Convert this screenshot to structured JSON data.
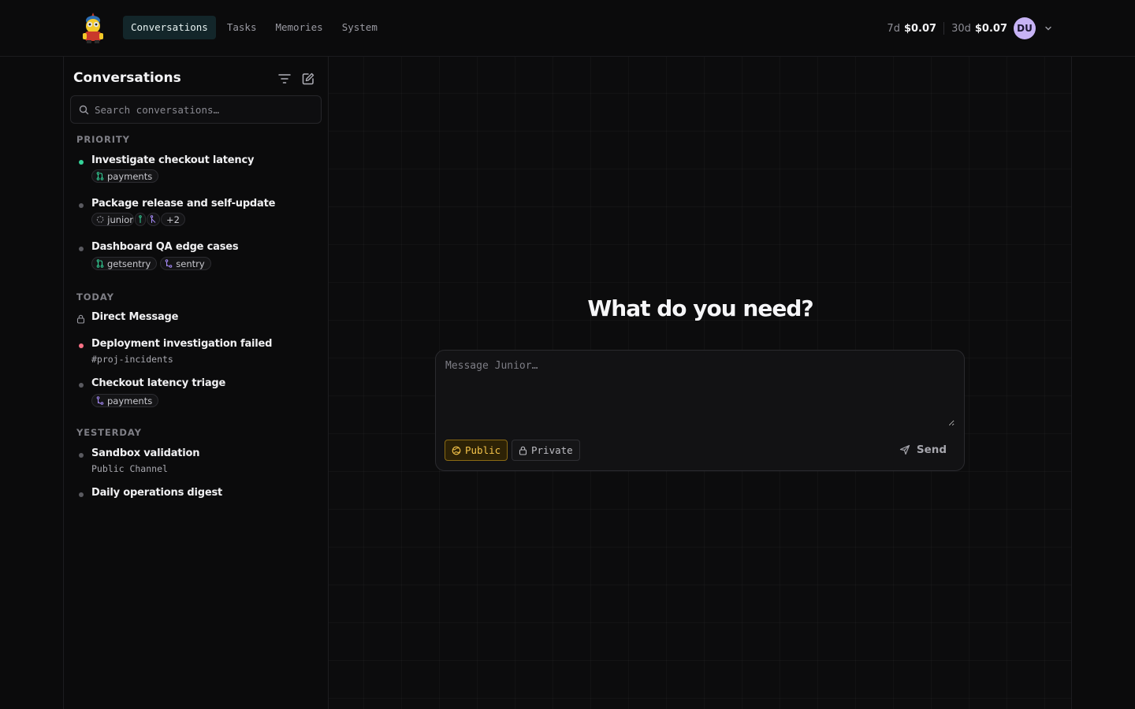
{
  "nav": {
    "tabs": [
      {
        "label": "Conversations",
        "active": true
      },
      {
        "label": "Tasks",
        "active": false
      },
      {
        "label": "Memories",
        "active": false
      },
      {
        "label": "System",
        "active": false
      }
    ]
  },
  "usage": {
    "week_label": "7d",
    "week_value": "$0.07",
    "month_label": "30d",
    "month_value": "$0.07",
    "avatar_initials": "DU"
  },
  "sidebar": {
    "title": "Conversations",
    "search_placeholder": "Search conversations…",
    "sections": {
      "priority": "PRIORITY",
      "today": "TODAY",
      "yesterday": "YESTERDAY"
    },
    "items": [
      {
        "title": "Investigate checkout latency",
        "status": "green",
        "chips": [
          "payments"
        ]
      },
      {
        "title": "Package release and self-update",
        "status": "gray",
        "chips": [
          "junior",
          "+2"
        ]
      },
      {
        "title": "Dashboard QA edge cases",
        "status": "gray",
        "chips": [
          "getsentry",
          "sentry"
        ]
      },
      {
        "title": "Direct Message",
        "status": "lock"
      },
      {
        "title": "Deployment investigation failed",
        "status": "red",
        "sub": "#proj-incidents"
      },
      {
        "title": "Checkout latency triage",
        "status": "gray",
        "chips": [
          "payments"
        ]
      },
      {
        "title": "Sandbox validation",
        "status": "gray",
        "sub": "Public Channel"
      },
      {
        "title": "Daily operations digest",
        "status": "gray"
      }
    ]
  },
  "main": {
    "heading": "What do you need?",
    "composer": {
      "placeholder": "Message Junior…",
      "public_label": "Public",
      "private_label": "Private",
      "send_label": "Send"
    }
  },
  "colors": {
    "accent_active_tab": "#13262a",
    "public_accent": "#f5c44a",
    "avatar_bg": "#c7b3f5",
    "status_green": "#34d399",
    "status_red": "#f87185"
  }
}
